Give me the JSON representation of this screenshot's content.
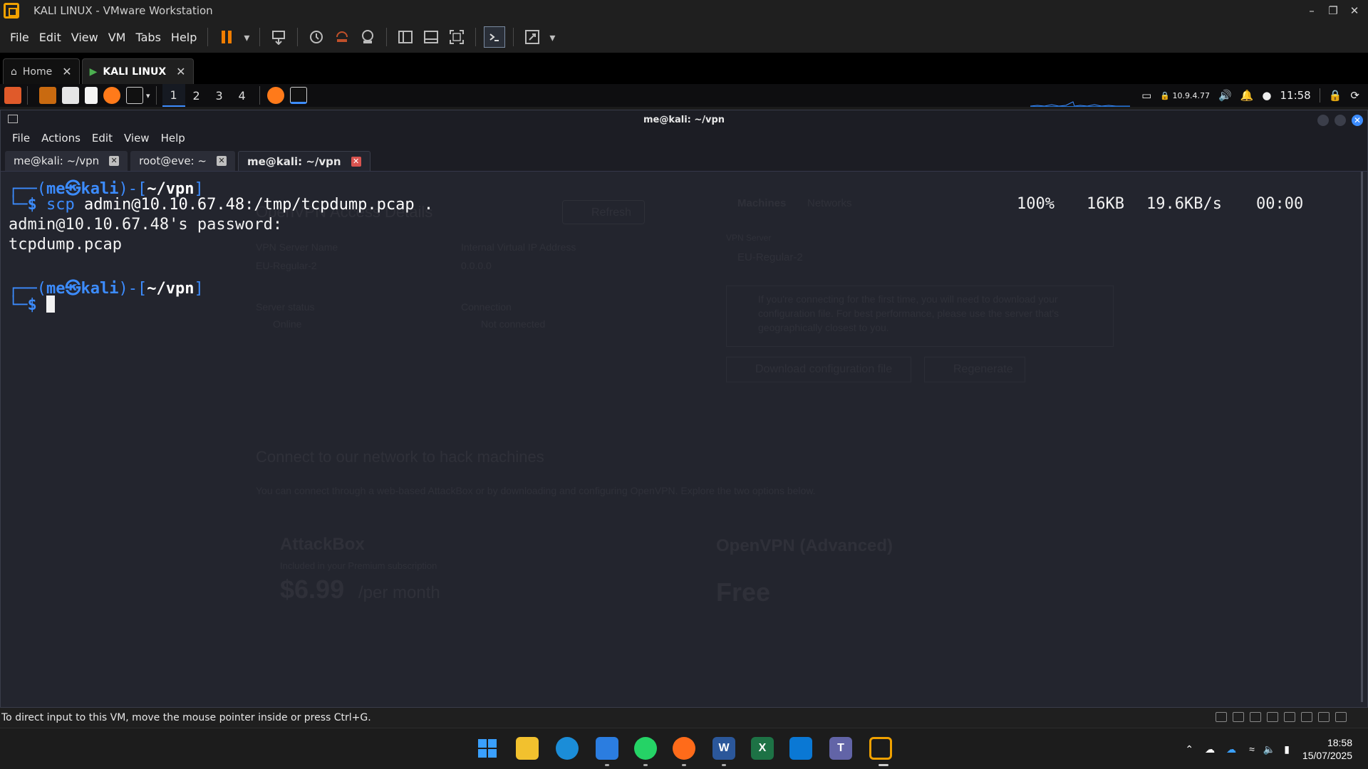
{
  "vmware": {
    "title": "KALI LINUX - VMware Workstation",
    "menus": [
      "File",
      "Edit",
      "View",
      "VM",
      "Tabs",
      "Help"
    ],
    "tabs": [
      {
        "label": "Home",
        "active": false
      },
      {
        "label": "KALI LINUX",
        "active": true
      }
    ],
    "status_text": "To direct input to this VM, move the mouse pointer inside or press Ctrl+G."
  },
  "kali_panel": {
    "workspaces": [
      "1",
      "2",
      "3",
      "4"
    ],
    "active_workspace": "1",
    "ip": "10.9.4.77",
    "time": "11:58"
  },
  "terminal": {
    "title": "me@kali: ~/vpn",
    "menus": [
      "File",
      "Actions",
      "Edit",
      "View",
      "Help"
    ],
    "tabs": [
      {
        "label": "me@kali: ~/vpn",
        "active": false
      },
      {
        "label": "root@eve: ~",
        "active": false
      },
      {
        "label": "me@kali: ~/vpn",
        "active": true
      }
    ],
    "prompt_user": "me",
    "prompt_host": "kali",
    "prompt_path": "~/vpn",
    "command_bin": "scp",
    "command_args": " admin@10.10.67.48:/tmp/tcpdump.pcap .",
    "password_line": "admin@10.10.67.48's password:",
    "transfer": {
      "file": "tcpdump.pcap",
      "percent": "100%",
      "size": "16KB",
      "rate": "19.6KB/s",
      "eta": "00:00"
    }
  },
  "background_page": {
    "title": "OpenVPN Access Details",
    "refresh": "Refresh",
    "tab_machines": "Machines",
    "tab_networks": "Networks",
    "vpn_server_name_label": "VPN Server Name",
    "vpn_server_name": "EU-Regular-2",
    "ip_label": "Internal Virtual IP Address",
    "ip_value": "0.0.0.0",
    "server_status_label": "Server status",
    "server_status": "Online",
    "connection_label": "Connection",
    "connection": "Not connected",
    "vpn_server_select_label": "VPN Server",
    "vpn_server_select": "EU-Regular-2",
    "info": "If you're connecting for the first time, you will need to download your configuration file. For best performance, please use the server that's geographically closest to you.",
    "download": "Download configuration file",
    "regenerate": "Regenerate",
    "heading": "Connect to our network to hack machines",
    "subheading": "You can connect through a web-based AttackBox or by downloading and configuring OpenVPN. Explore the two options below.",
    "attackbox": "AttackBox",
    "attackbox_sub": "Included in your Premium subscription",
    "price": "$6.99",
    "per": "/per month",
    "openvpn": "OpenVPN (Advanced)",
    "free": "Free"
  },
  "taskbar": {
    "time": "18:58",
    "date": "15/07/2025"
  },
  "colors": {
    "kali_blue": "#3c8cff",
    "terminal_bg": "#23252e",
    "vmware_orange": "#f07d00"
  }
}
